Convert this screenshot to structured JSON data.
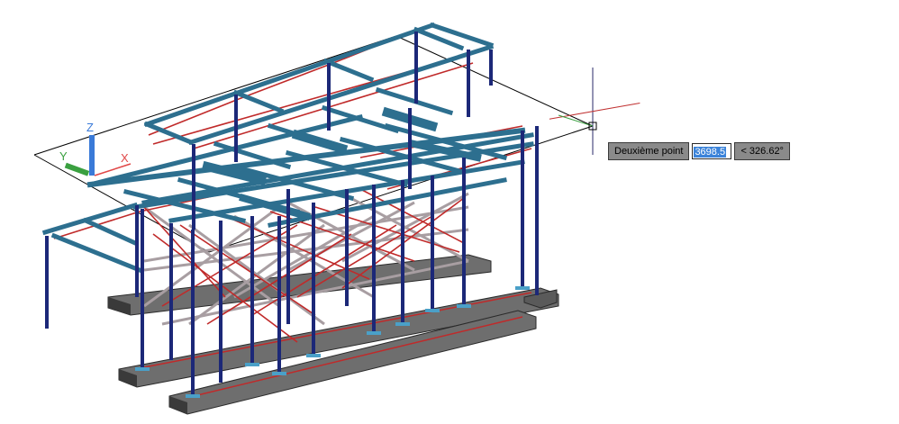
{
  "dynamic_input": {
    "prompt_label": "Deuxième point",
    "distance_value": "3698.5",
    "angle_value": "< 326.62°"
  },
  "ucs_icon": {
    "x_label": "X",
    "y_label": "Y",
    "z_label": "Z",
    "x_color": "#e04848",
    "y_color": "#3aa040",
    "z_color": "#3a7ad8"
  },
  "colors": {
    "column": "#1c2878",
    "beam": "#2d6f8f",
    "brace": "#c02a2a",
    "brace_gray": "#9a8f93",
    "foundation": "#4a4a4a",
    "crosshair": "#000000"
  }
}
